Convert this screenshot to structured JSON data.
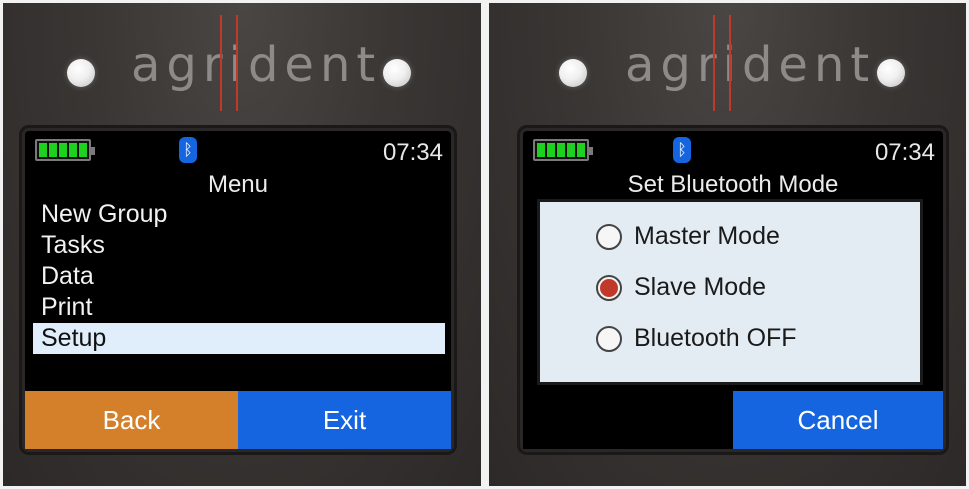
{
  "left_screen": {
    "brand": "agrident",
    "clock": "07:34",
    "title": "Menu",
    "menu_items": [
      "New Group",
      "Tasks",
      "Data",
      "Print",
      "Setup"
    ],
    "selected_item": "Setup",
    "softkeys": {
      "back": "Back",
      "exit": "Exit"
    },
    "colors": {
      "battery": "#1fd11f",
      "back_key": "#d4802a",
      "exit_key": "#1565e0",
      "selection": "#dfeefa"
    }
  },
  "right_screen": {
    "brand": "agrident",
    "clock": "07:34",
    "title": "Set Bluetooth Mode",
    "options": [
      {
        "label": "Master Mode",
        "selected": false
      },
      {
        "label": "Slave Mode",
        "selected": true
      },
      {
        "label": "Bluetooth OFF",
        "selected": false
      }
    ],
    "softkeys": {
      "cancel": "Cancel"
    },
    "colors": {
      "radio_selected": "#c0392b",
      "cancel_key": "#1565e0",
      "dialog": "#e4ecf3"
    }
  },
  "icons": {
    "battery": "battery-full-icon",
    "bluetooth": "bluetooth-icon"
  }
}
